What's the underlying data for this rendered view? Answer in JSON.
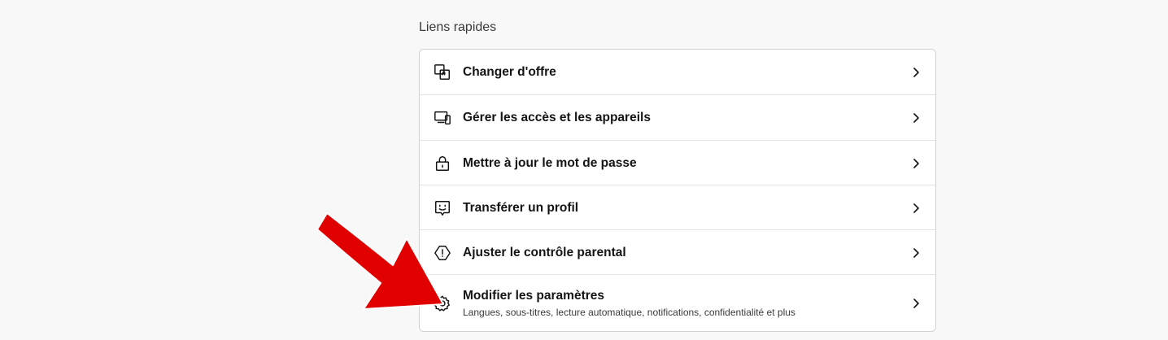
{
  "section": {
    "title": "Liens rapides"
  },
  "items": [
    {
      "label": "Changer d'offre",
      "icon": "swap-plan-icon"
    },
    {
      "label": "Gérer les accès et les appareils",
      "icon": "devices-icon"
    },
    {
      "label": "Mettre à jour le mot de passe",
      "icon": "lock-icon"
    },
    {
      "label": "Transférer un profil",
      "icon": "profile-transfer-icon"
    },
    {
      "label": "Ajuster le contrôle parental",
      "icon": "parental-control-icon"
    },
    {
      "label": "Modifier les paramètres",
      "sublabel": "Langues, sous-titres, lecture automatique, notifications, confidentialité et plus",
      "icon": "gear-icon"
    }
  ],
  "colors": {
    "annotation_arrow": "#e00000",
    "background": "#f8f8f8",
    "card": "#ffffff"
  }
}
